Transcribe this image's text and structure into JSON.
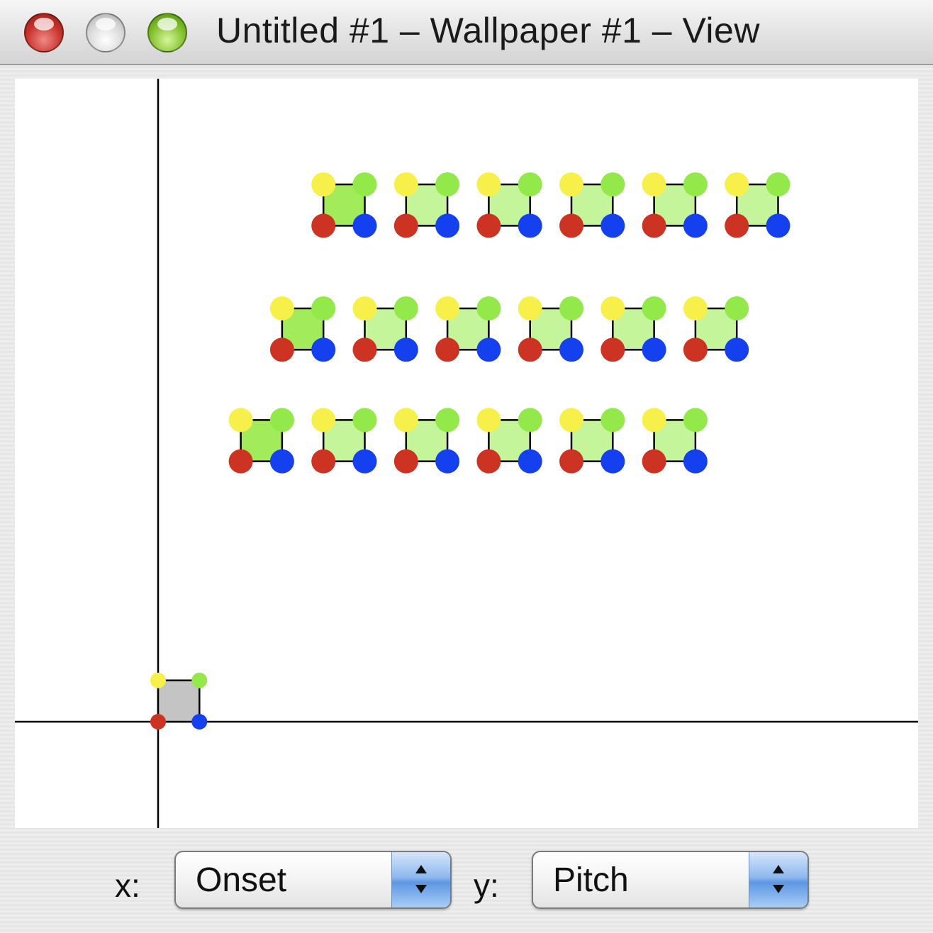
{
  "window": {
    "title": "Untitled #1 – Wallpaper #1 – View",
    "buttons": [
      "close",
      "minimize",
      "zoom"
    ]
  },
  "view": {
    "x_selector": {
      "label": "x:",
      "value": "Onset"
    },
    "y_selector": {
      "label": "y:",
      "value": "Pitch"
    }
  },
  "chart_data": {
    "type": "scatter",
    "description_colors": {
      "corner_top_left": "#f8f04a",
      "corner_top_right": "#93e84a",
      "corner_bottom_left": "#cc3322",
      "corner_bottom_right": "#1540f0",
      "motif_fill": "#c4f59a",
      "motif_fill_first": "#a2ec5c",
      "base_motif_fill": "#c4c4c4"
    },
    "base_motif": {
      "x": 0,
      "y": 0
    },
    "rows": [
      {
        "y": 12,
        "x": [
          4,
          6,
          8,
          10,
          12,
          14
        ]
      },
      {
        "y": 9,
        "x": [
          3,
          5,
          7,
          9,
          11,
          13
        ]
      },
      {
        "y": 6.3,
        "x": [
          2,
          4,
          6,
          8,
          10,
          12
        ]
      }
    ],
    "grid": false,
    "axes": "origin-cross"
  }
}
